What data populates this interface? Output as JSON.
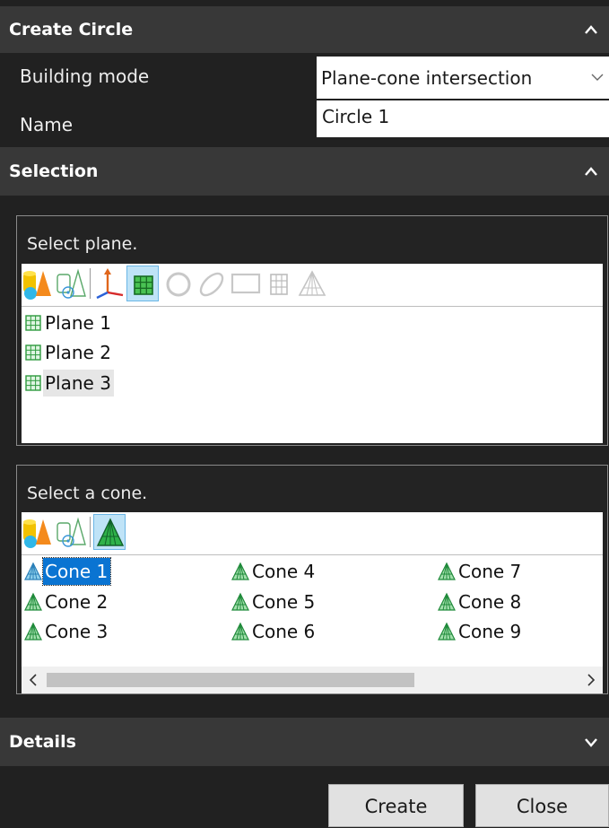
{
  "create_circle": {
    "title": "Create Circle"
  },
  "form": {
    "building_mode_label": "Building mode",
    "building_mode_value": "Plane-cone intersection",
    "name_label": "Name",
    "name_value": "Circle 1"
  },
  "selection": {
    "title": "Selection",
    "plane_group": {
      "prompt": "Select plane.",
      "items": [
        {
          "label": "Plane 1"
        },
        {
          "label": "Plane 2"
        },
        {
          "label": "Plane 3"
        }
      ]
    },
    "cone_group": {
      "prompt": "Select a cone.",
      "items": [
        {
          "label": "Cone 1"
        },
        {
          "label": "Cone 2"
        },
        {
          "label": "Cone 3"
        },
        {
          "label": "Cone 4"
        },
        {
          "label": "Cone 5"
        },
        {
          "label": "Cone 6"
        },
        {
          "label": "Cone 7"
        },
        {
          "label": "Cone 8"
        },
        {
          "label": "Cone 9"
        }
      ]
    }
  },
  "details": {
    "title": "Details"
  },
  "footer": {
    "create_label": "Create",
    "close_label": "Close"
  },
  "colors": {
    "header_bg": "#383838",
    "panel_bg": "#212121",
    "selection_blue": "#0a74d2",
    "plane_icon": "#2e9a3e",
    "cone_icon": "#1f8a3a"
  }
}
